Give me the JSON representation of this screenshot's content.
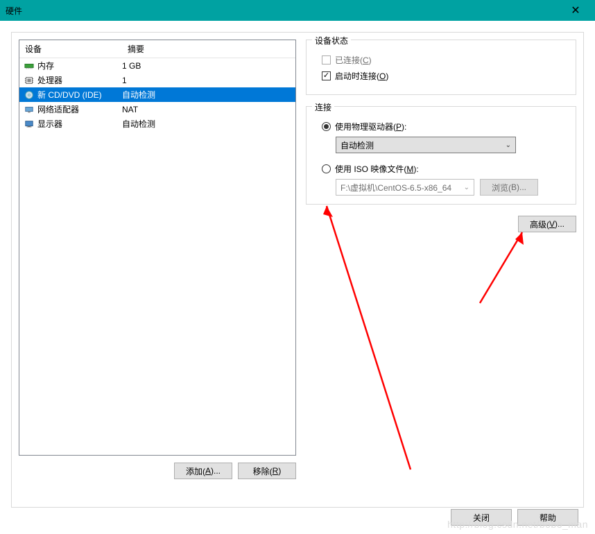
{
  "title": "硬件",
  "columns": {
    "device": "设备",
    "summary": "摘要"
  },
  "devices": [
    {
      "icon": "memory-icon",
      "name": "内存",
      "summary": "1 GB",
      "selected": false
    },
    {
      "icon": "cpu-icon",
      "name": "处理器",
      "summary": "1",
      "selected": false
    },
    {
      "icon": "cd-icon",
      "name": "新 CD/DVD (IDE)",
      "summary": "自动检测",
      "selected": true
    },
    {
      "icon": "network-icon",
      "name": "网络适配器",
      "summary": "NAT",
      "selected": false
    },
    {
      "icon": "display-icon",
      "name": "显示器",
      "summary": "自动检测",
      "selected": false
    }
  ],
  "buttons": {
    "add": {
      "label": "添加(",
      "accel": "A",
      "suffix": ")..."
    },
    "remove": {
      "label": "移除(",
      "accel": "R",
      "suffix": ")"
    },
    "browse": {
      "label": "浏览(",
      "accel": "B",
      "suffix": ")..."
    },
    "advanced": {
      "label": "高级(",
      "accel": "V",
      "suffix": ")..."
    },
    "close": "关闭",
    "help": "帮助"
  },
  "status_group": {
    "legend": "设备状态",
    "connected": {
      "label": "已连接(",
      "accel": "C",
      "suffix": ")",
      "checked": false,
      "disabled": true
    },
    "connect_on_power": {
      "label": "启动时连接(",
      "accel": "O",
      "suffix": ")",
      "checked": true,
      "disabled": false
    }
  },
  "connection_group": {
    "legend": "连接",
    "physical": {
      "label": "使用物理驱动器(",
      "accel": "P",
      "suffix": "):",
      "selected": true
    },
    "physical_drive_value": "自动检测",
    "iso": {
      "label": "使用 ISO 映像文件(",
      "accel": "M",
      "suffix": "):",
      "selected": false
    },
    "iso_path": "F:\\虚拟机\\CentOS-6.5-x86_64"
  },
  "watermark": "http://blog.csdn.net/bobo_man"
}
